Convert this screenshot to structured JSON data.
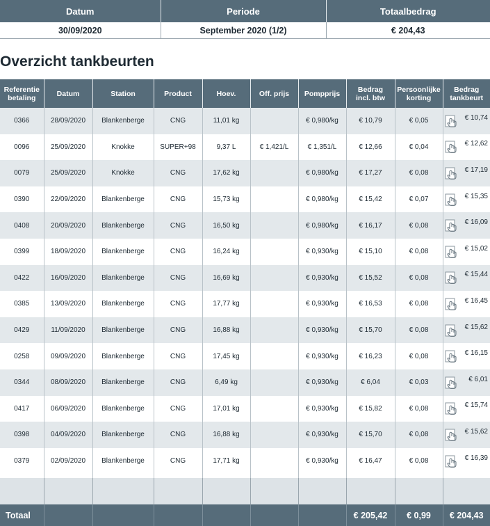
{
  "summary": {
    "headers": {
      "datum": "Datum",
      "periode": "Periode",
      "totaalbedrag": "Totaalbedrag"
    },
    "values": {
      "datum": "30/09/2020",
      "periode": "September 2020 (1/2)",
      "totaalbedrag": "€ 204,43"
    }
  },
  "title": "Overzicht tankbeurten",
  "columns": {
    "referentie_line1": "Referentie",
    "referentie_line2": "betaling",
    "datum": "Datum",
    "station": "Station",
    "product": "Product",
    "hoev": "Hoev.",
    "off_prijs": "Off. prijs",
    "pompprijs": "Pompprijs",
    "bedrag_incl_line1": "Bedrag",
    "bedrag_incl_line2": "incl. btw",
    "korting_line1": "Persoonlijke",
    "korting_line2": "korting",
    "tankbeurt_line1": "Bedrag",
    "tankbeurt_line2": "tankbeurt"
  },
  "rows": [
    {
      "ref": "0366",
      "datum": "28/09/2020",
      "station": "Blankenberge",
      "product": "CNG",
      "hoev": "11,01 kg",
      "off_prijs": "",
      "pompprijs": "€ 0,980/kg",
      "bedrag": "€ 10,79",
      "korting": "€ 0,05",
      "tankbeurt": "€ 10,74"
    },
    {
      "ref": "0096",
      "datum": "25/09/2020",
      "station": "Knokke",
      "product": "SUPER+98",
      "hoev": "9,37 L",
      "off_prijs": "€ 1,421/L",
      "pompprijs": "€ 1,351/L",
      "bedrag": "€ 12,66",
      "korting": "€ 0,04",
      "tankbeurt": "€ 12,62"
    },
    {
      "ref": "0079",
      "datum": "25/09/2020",
      "station": "Knokke",
      "product": "CNG",
      "hoev": "17,62 kg",
      "off_prijs": "",
      "pompprijs": "€ 0,980/kg",
      "bedrag": "€ 17,27",
      "korting": "€ 0,08",
      "tankbeurt": "€ 17,19"
    },
    {
      "ref": "0390",
      "datum": "22/09/2020",
      "station": "Blankenberge",
      "product": "CNG",
      "hoev": "15,73 kg",
      "off_prijs": "",
      "pompprijs": "€ 0,980/kg",
      "bedrag": "€ 15,42",
      "korting": "€ 0,07",
      "tankbeurt": "€ 15,35"
    },
    {
      "ref": "0408",
      "datum": "20/09/2020",
      "station": "Blankenberge",
      "product": "CNG",
      "hoev": "16,50 kg",
      "off_prijs": "",
      "pompprijs": "€ 0,980/kg",
      "bedrag": "€ 16,17",
      "korting": "€ 0,08",
      "tankbeurt": "€ 16,09"
    },
    {
      "ref": "0399",
      "datum": "18/09/2020",
      "station": "Blankenberge",
      "product": "CNG",
      "hoev": "16,24 kg",
      "off_prijs": "",
      "pompprijs": "€ 0,930/kg",
      "bedrag": "€ 15,10",
      "korting": "€ 0,08",
      "tankbeurt": "€ 15,02"
    },
    {
      "ref": "0422",
      "datum": "16/09/2020",
      "station": "Blankenberge",
      "product": "CNG",
      "hoev": "16,69 kg",
      "off_prijs": "",
      "pompprijs": "€ 0,930/kg",
      "bedrag": "€ 15,52",
      "korting": "€ 0,08",
      "tankbeurt": "€ 15,44"
    },
    {
      "ref": "0385",
      "datum": "13/09/2020",
      "station": "Blankenberge",
      "product": "CNG",
      "hoev": "17,77 kg",
      "off_prijs": "",
      "pompprijs": "€ 0,930/kg",
      "bedrag": "€ 16,53",
      "korting": "€ 0,08",
      "tankbeurt": "€ 16,45"
    },
    {
      "ref": "0429",
      "datum": "11/09/2020",
      "station": "Blankenberge",
      "product": "CNG",
      "hoev": "16,88 kg",
      "off_prijs": "",
      "pompprijs": "€ 0,930/kg",
      "bedrag": "€ 15,70",
      "korting": "€ 0,08",
      "tankbeurt": "€ 15,62"
    },
    {
      "ref": "0258",
      "datum": "09/09/2020",
      "station": "Blankenberge",
      "product": "CNG",
      "hoev": "17,45 kg",
      "off_prijs": "",
      "pompprijs": "€ 0,930/kg",
      "bedrag": "€ 16,23",
      "korting": "€ 0,08",
      "tankbeurt": "€ 16,15"
    },
    {
      "ref": "0344",
      "datum": "08/09/2020",
      "station": "Blankenberge",
      "product": "CNG",
      "hoev": "6,49 kg",
      "off_prijs": "",
      "pompprijs": "€ 0,930/kg",
      "bedrag": "€ 6,04",
      "korting": "€ 0,03",
      "tankbeurt": "€ 6,01"
    },
    {
      "ref": "0417",
      "datum": "06/09/2020",
      "station": "Blankenberge",
      "product": "CNG",
      "hoev": "17,01 kg",
      "off_prijs": "",
      "pompprijs": "€ 0,930/kg",
      "bedrag": "€ 15,82",
      "korting": "€ 0,08",
      "tankbeurt": "€ 15,74"
    },
    {
      "ref": "0398",
      "datum": "04/09/2020",
      "station": "Blankenberge",
      "product": "CNG",
      "hoev": "16,88 kg",
      "off_prijs": "",
      "pompprijs": "€ 0,930/kg",
      "bedrag": "€ 15,70",
      "korting": "€ 0,08",
      "tankbeurt": "€ 15,62"
    },
    {
      "ref": "0379",
      "datum": "02/09/2020",
      "station": "Blankenberge",
      "product": "CNG",
      "hoev": "17,71 kg",
      "off_prijs": "",
      "pompprijs": "€ 0,930/kg",
      "bedrag": "€ 16,47",
      "korting": "€ 0,08",
      "tankbeurt": "€ 16,39"
    }
  ],
  "totals": {
    "label": "Totaal",
    "bedrag": "€ 205,42",
    "korting": "€ 0,99",
    "tankbeurt": "€ 204,43"
  },
  "icons": {
    "row_action": "hand-pointer-icon"
  },
  "colors": {
    "header_bg": "#566c7a",
    "stripe": "#e3e8eb",
    "text": "#1e2a33"
  }
}
